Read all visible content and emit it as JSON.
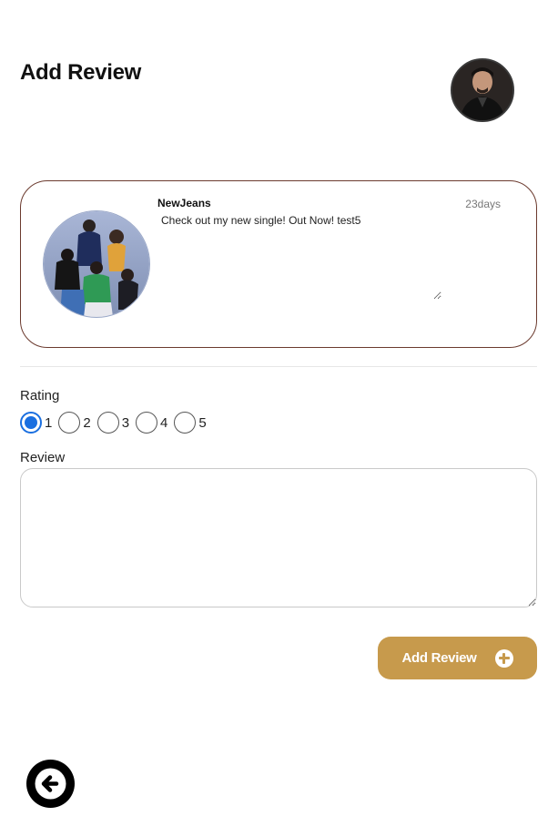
{
  "page": {
    "title": "Add Review"
  },
  "user": {
    "avatar_icon": "user-avatar-photo"
  },
  "post": {
    "artist_name": "NewJeans",
    "age": "23days",
    "text": "Check out my new single! Out Now! test5",
    "image_icon": "artist-group-photo"
  },
  "rating": {
    "label": "Rating",
    "options": [
      "1",
      "2",
      "3",
      "4",
      "5"
    ],
    "selected": "1"
  },
  "review": {
    "label": "Review",
    "value": "",
    "placeholder": ""
  },
  "actions": {
    "add_review_label": "Add Review",
    "add_icon": "plus-circle-icon",
    "back_icon": "arrow-left-icon"
  },
  "colors": {
    "accent": "#c79a4c",
    "card_border": "#6b3a2e",
    "radio_selected": "#1a6fe0",
    "back_button": "#000000"
  }
}
